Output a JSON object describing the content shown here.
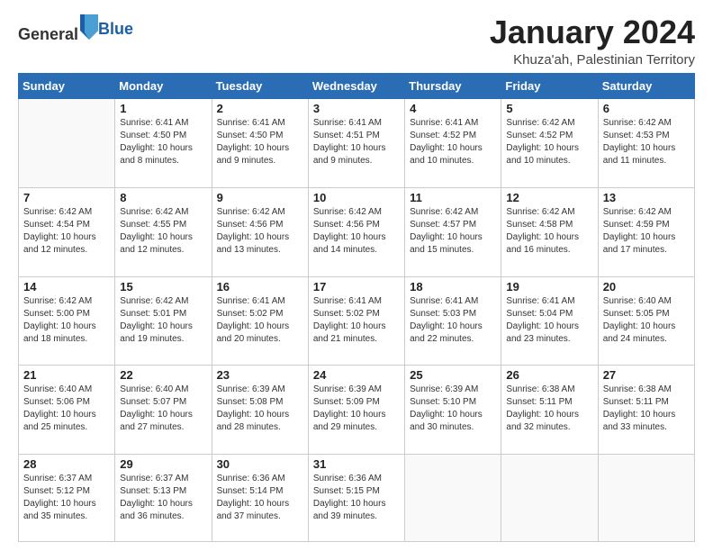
{
  "header": {
    "logo_general": "General",
    "logo_blue": "Blue",
    "title": "January 2024",
    "location": "Khuza'ah, Palestinian Territory"
  },
  "days_of_week": [
    "Sunday",
    "Monday",
    "Tuesday",
    "Wednesday",
    "Thursday",
    "Friday",
    "Saturday"
  ],
  "weeks": [
    [
      {
        "day": "",
        "info": ""
      },
      {
        "day": "1",
        "info": "Sunrise: 6:41 AM\nSunset: 4:50 PM\nDaylight: 10 hours\nand 8 minutes."
      },
      {
        "day": "2",
        "info": "Sunrise: 6:41 AM\nSunset: 4:50 PM\nDaylight: 10 hours\nand 9 minutes."
      },
      {
        "day": "3",
        "info": "Sunrise: 6:41 AM\nSunset: 4:51 PM\nDaylight: 10 hours\nand 9 minutes."
      },
      {
        "day": "4",
        "info": "Sunrise: 6:41 AM\nSunset: 4:52 PM\nDaylight: 10 hours\nand 10 minutes."
      },
      {
        "day": "5",
        "info": "Sunrise: 6:42 AM\nSunset: 4:52 PM\nDaylight: 10 hours\nand 10 minutes."
      },
      {
        "day": "6",
        "info": "Sunrise: 6:42 AM\nSunset: 4:53 PM\nDaylight: 10 hours\nand 11 minutes."
      }
    ],
    [
      {
        "day": "7",
        "info": "Sunrise: 6:42 AM\nSunset: 4:54 PM\nDaylight: 10 hours\nand 12 minutes."
      },
      {
        "day": "8",
        "info": "Sunrise: 6:42 AM\nSunset: 4:55 PM\nDaylight: 10 hours\nand 12 minutes."
      },
      {
        "day": "9",
        "info": "Sunrise: 6:42 AM\nSunset: 4:56 PM\nDaylight: 10 hours\nand 13 minutes."
      },
      {
        "day": "10",
        "info": "Sunrise: 6:42 AM\nSunset: 4:56 PM\nDaylight: 10 hours\nand 14 minutes."
      },
      {
        "day": "11",
        "info": "Sunrise: 6:42 AM\nSunset: 4:57 PM\nDaylight: 10 hours\nand 15 minutes."
      },
      {
        "day": "12",
        "info": "Sunrise: 6:42 AM\nSunset: 4:58 PM\nDaylight: 10 hours\nand 16 minutes."
      },
      {
        "day": "13",
        "info": "Sunrise: 6:42 AM\nSunset: 4:59 PM\nDaylight: 10 hours\nand 17 minutes."
      }
    ],
    [
      {
        "day": "14",
        "info": "Sunrise: 6:42 AM\nSunset: 5:00 PM\nDaylight: 10 hours\nand 18 minutes."
      },
      {
        "day": "15",
        "info": "Sunrise: 6:42 AM\nSunset: 5:01 PM\nDaylight: 10 hours\nand 19 minutes."
      },
      {
        "day": "16",
        "info": "Sunrise: 6:41 AM\nSunset: 5:02 PM\nDaylight: 10 hours\nand 20 minutes."
      },
      {
        "day": "17",
        "info": "Sunrise: 6:41 AM\nSunset: 5:02 PM\nDaylight: 10 hours\nand 21 minutes."
      },
      {
        "day": "18",
        "info": "Sunrise: 6:41 AM\nSunset: 5:03 PM\nDaylight: 10 hours\nand 22 minutes."
      },
      {
        "day": "19",
        "info": "Sunrise: 6:41 AM\nSunset: 5:04 PM\nDaylight: 10 hours\nand 23 minutes."
      },
      {
        "day": "20",
        "info": "Sunrise: 6:40 AM\nSunset: 5:05 PM\nDaylight: 10 hours\nand 24 minutes."
      }
    ],
    [
      {
        "day": "21",
        "info": "Sunrise: 6:40 AM\nSunset: 5:06 PM\nDaylight: 10 hours\nand 25 minutes."
      },
      {
        "day": "22",
        "info": "Sunrise: 6:40 AM\nSunset: 5:07 PM\nDaylight: 10 hours\nand 27 minutes."
      },
      {
        "day": "23",
        "info": "Sunrise: 6:39 AM\nSunset: 5:08 PM\nDaylight: 10 hours\nand 28 minutes."
      },
      {
        "day": "24",
        "info": "Sunrise: 6:39 AM\nSunset: 5:09 PM\nDaylight: 10 hours\nand 29 minutes."
      },
      {
        "day": "25",
        "info": "Sunrise: 6:39 AM\nSunset: 5:10 PM\nDaylight: 10 hours\nand 30 minutes."
      },
      {
        "day": "26",
        "info": "Sunrise: 6:38 AM\nSunset: 5:11 PM\nDaylight: 10 hours\nand 32 minutes."
      },
      {
        "day": "27",
        "info": "Sunrise: 6:38 AM\nSunset: 5:11 PM\nDaylight: 10 hours\nand 33 minutes."
      }
    ],
    [
      {
        "day": "28",
        "info": "Sunrise: 6:37 AM\nSunset: 5:12 PM\nDaylight: 10 hours\nand 35 minutes."
      },
      {
        "day": "29",
        "info": "Sunrise: 6:37 AM\nSunset: 5:13 PM\nDaylight: 10 hours\nand 36 minutes."
      },
      {
        "day": "30",
        "info": "Sunrise: 6:36 AM\nSunset: 5:14 PM\nDaylight: 10 hours\nand 37 minutes."
      },
      {
        "day": "31",
        "info": "Sunrise: 6:36 AM\nSunset: 5:15 PM\nDaylight: 10 hours\nand 39 minutes."
      },
      {
        "day": "",
        "info": ""
      },
      {
        "day": "",
        "info": ""
      },
      {
        "day": "",
        "info": ""
      }
    ]
  ]
}
